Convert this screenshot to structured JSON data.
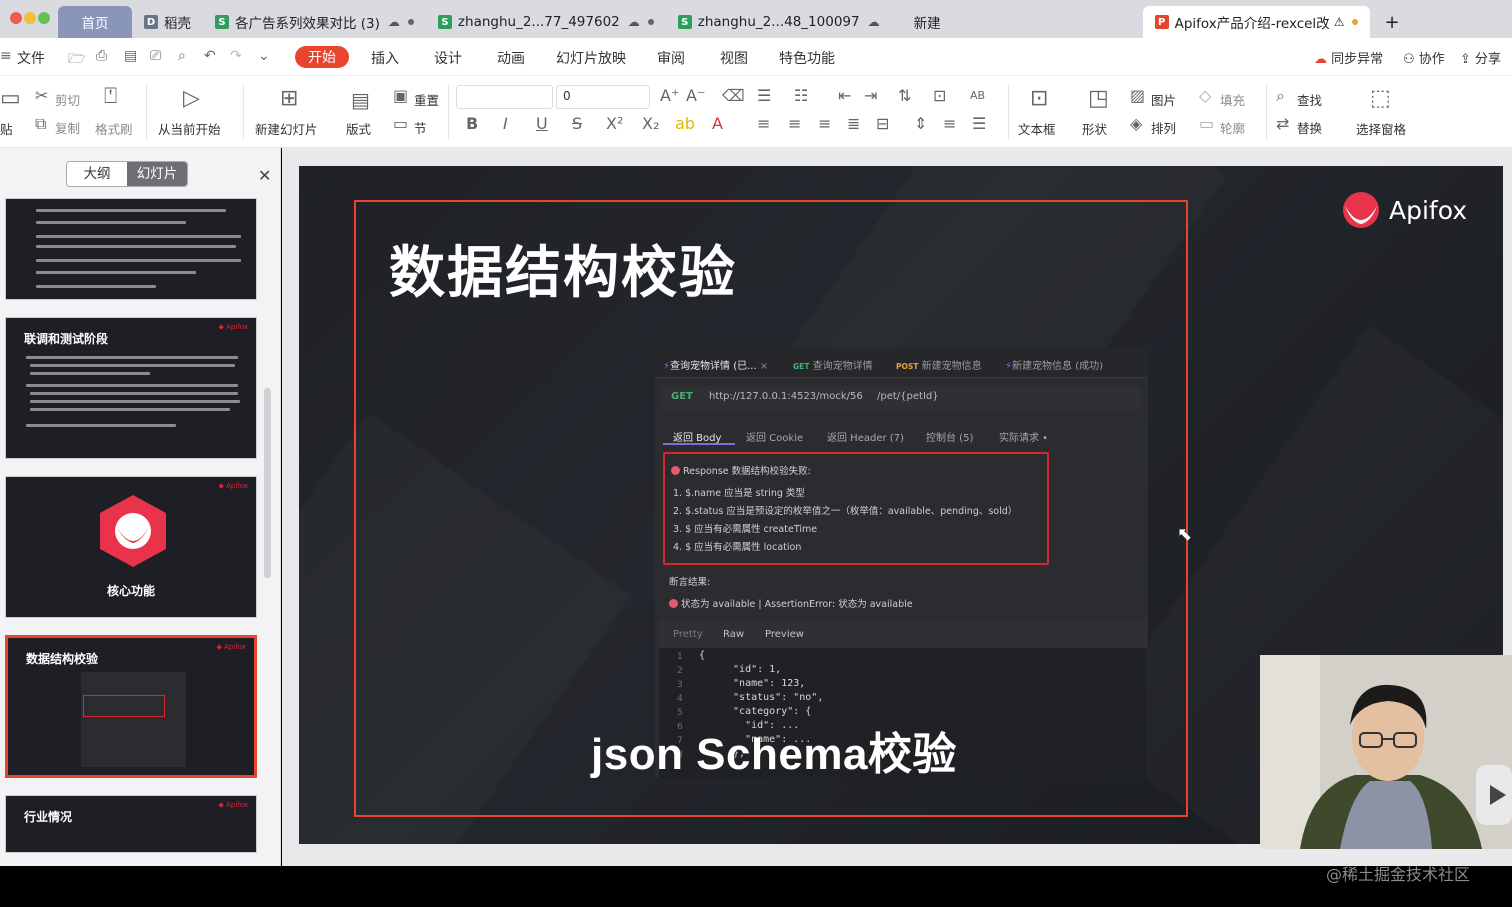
{
  "tabs": [
    {
      "label": "首页"
    },
    {
      "label": "稻壳"
    },
    {
      "label": "各广告系列效果对比 (3)"
    },
    {
      "label": "zhanghu_2...77_497602"
    },
    {
      "label": "zhanghu_2...48_100097"
    },
    {
      "label": "新建"
    },
    {
      "label": "Apifox产品介绍-rexcel改"
    }
  ],
  "menu": {
    "file": "文件",
    "items": [
      "开始",
      "插入",
      "设计",
      "动画",
      "幻灯片放映",
      "审阅",
      "视图",
      "特色功能"
    ],
    "right": [
      "同步异常",
      "协作",
      "分享"
    ]
  },
  "ribbon": {
    "paste": "贴",
    "cut": "剪切",
    "copy": "复制",
    "format_painter": "格式刷",
    "play_from_current": "从当前开始",
    "new_slide": "新建幻灯片",
    "layout": "版式",
    "reset": "重置",
    "section": "节",
    "font_size": "0",
    "textbox": "文本框",
    "shape": "形状",
    "picture": "图片",
    "arrange": "排列",
    "fill": "填充",
    "outline": "轮廓",
    "find": "查找",
    "replace": "替换",
    "select_pane": "选择窗格"
  },
  "panel": {
    "outline_tab": "大纲",
    "slides_tab": "幻灯片",
    "thumbs": [
      {
        "title": ""
      },
      {
        "title": "联调和测试阶段"
      },
      {
        "title": "核心功能"
      },
      {
        "title": "数据结构校验"
      },
      {
        "title": "行业情况"
      }
    ]
  },
  "slide": {
    "title": "数据结构校验",
    "brand": "Apifox",
    "caption": "json Schema校验",
    "shot": {
      "tabs": [
        "查询宠物详情 (已...",
        "查询宠物详情",
        "新建宠物信息",
        "新建宠物信息 (成功)"
      ],
      "method_get": "GET",
      "method_post": "POST",
      "url": "http://127.0.0.1:4523/mock/56",
      "path": "/pet/{petId}",
      "subtabs": [
        "返回 Body",
        "返回 Cookie",
        "返回 Header (7)",
        "控制台 (5)",
        "实际请求 •"
      ],
      "error_title": "Response 数据结构校验失败:",
      "errors": [
        "1. $.name 应当是 string 类型",
        "2. $.status 应当是预设定的枚举值之一（枚举值：available、pending、sold）",
        "3. $ 应当有必需属性 createTime",
        "4. $ 应当有必需属性 location"
      ],
      "assert_title": "断言结果:",
      "assert_line": "状态为 available | AssertionError: 状态为 available",
      "view_tabs": [
        "Pretty",
        "Raw",
        "Preview"
      ],
      "code": [
        "{",
        "  \"id\": 1,",
        "  \"name\": 123,",
        "  \"status\": \"no\",",
        "  \"category\": {",
        "    \"id\": ...",
        "    \"name\": ...",
        "  },"
      ]
    }
  },
  "watermark": "@稀土掘金技术社区",
  "colors": {
    "accent": "#e8452e",
    "tabbar": "#d9dbe0",
    "slide_bg": "#1f2126"
  }
}
